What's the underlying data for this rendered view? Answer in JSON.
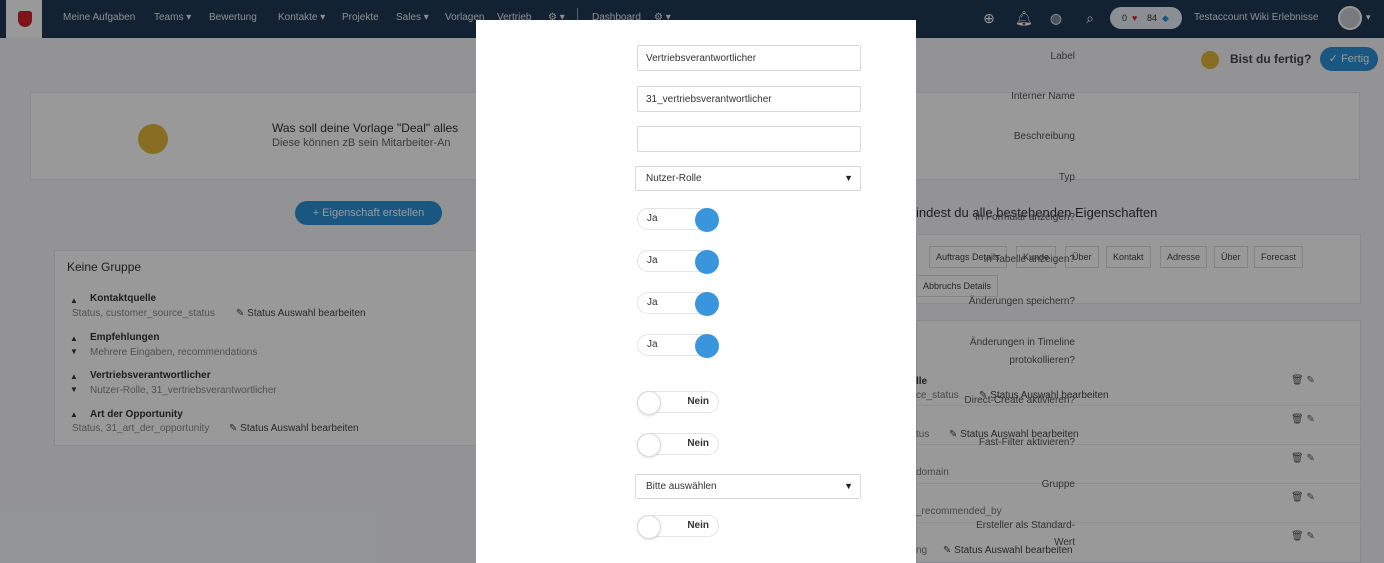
{
  "nav": {
    "items": [
      "Meine Aufgaben",
      "Teams ▾",
      "Bewertung",
      "Kontakte ▾",
      "Projekte",
      "Sales ▾",
      "Vorlagen",
      "Vertrieb",
      "⚙ ▾",
      "Dashboard",
      "⚙ ▾"
    ],
    "stats_left": "0",
    "stats_right": "84",
    "user_name": "Testaccount Wiki Erlebnisse"
  },
  "subheader": {
    "question": "Bist du fertig?",
    "finish_button": "✓ Fertig"
  },
  "intro": {
    "question": "Was soll deine Vorlage \"Deal\" alles",
    "subtext": "Diese können zB sein Mitarbeiter-An"
  },
  "left": {
    "add_property_button": "+ Eigenschaft erstellen",
    "group_title": "Keine Gruppe",
    "properties": [
      {
        "name": "Kontaktquelle",
        "meta": "Status, customer_source_status",
        "edit": "✎ Status Auswahl bearbeiten"
      },
      {
        "name": "Empfehlungen",
        "meta": "Mehrere Eingaben, recommendations",
        "edit": ""
      },
      {
        "name": "Vertriebsverantwortlicher",
        "meta": "Nutzer-Rolle, 31_vertriebsverantwortlicher",
        "edit": ""
      },
      {
        "name": "Art der Opportunity",
        "meta": "Status, 31_art_der_opportunity",
        "edit": "✎ Status Auswahl bearbeiten"
      }
    ]
  },
  "right": {
    "heading": "indest du alle bestehenden Eigenschaften",
    "chips": [
      "Auftrags Details",
      "Kunde",
      "Über",
      "Kontakt",
      "Adresse",
      "Über",
      "Forecast",
      "Abbruchs Details"
    ],
    "rows": [
      {
        "title": "lle",
        "meta": "ce_status",
        "edit": "✎ Status Auswahl bearbeiten"
      },
      {
        "title": "",
        "meta": "tus",
        "edit": "✎ Status Auswahl bearbeiten"
      },
      {
        "title": "",
        "meta": "domain",
        "edit": ""
      },
      {
        "title": "",
        "meta": "_recommended_by",
        "edit": ""
      },
      {
        "title": "",
        "meta": "ng",
        "edit": "✎ Status Auswahl bearbeiten"
      }
    ]
  },
  "modal": {
    "label": {
      "label": "Label",
      "value": "Vertriebsverantwortlicher"
    },
    "internal_name": {
      "label": "Interner Name",
      "value": "31_vertriebsverantwortlicher"
    },
    "description": {
      "label": "Beschreibung",
      "value": ""
    },
    "type": {
      "label": "Typ",
      "value": "Nutzer-Rolle"
    },
    "show_in_form": {
      "label": "In Formular anzeigen?",
      "value": "Ja",
      "on": true
    },
    "show_in_table": {
      "label": "In Tabelle anzeigen?",
      "value": "Ja",
      "on": true
    },
    "save_changes": {
      "label": "Änderungen speichern?",
      "value": "Ja",
      "on": true
    },
    "timeline_log": {
      "label_line1": "Änderungen in Timeline",
      "label_line2": "protokollieren?",
      "value": "Ja",
      "on": true
    },
    "direct_create": {
      "label": "Direct-Create aktivieren?",
      "value": "Nein",
      "on": false
    },
    "fast_filter": {
      "label": "Fast-Filter aktivieren?",
      "value": "Nein",
      "on": false
    },
    "group": {
      "label": "Gruppe",
      "value": "Bitte auswählen"
    },
    "creator_default": {
      "label_line1": "Ersteller als Standard-",
      "label_line2": "Wert",
      "value": "Nein",
      "on": false
    }
  }
}
